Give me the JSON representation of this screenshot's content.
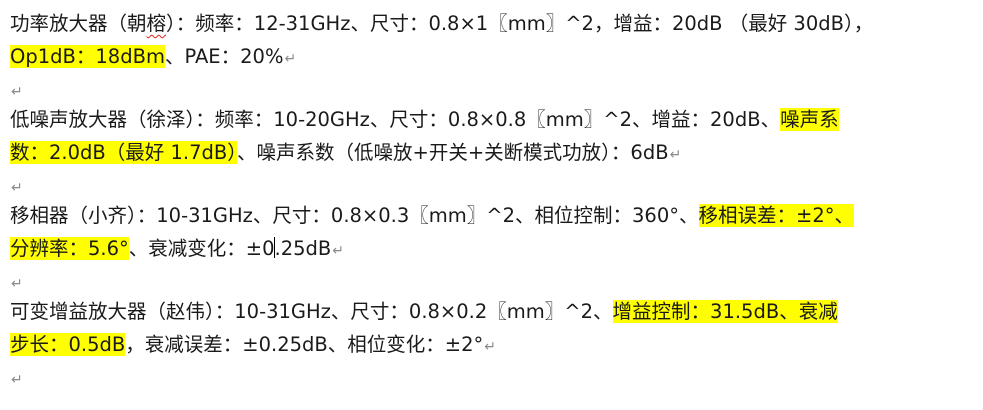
{
  "document": {
    "p1": {
      "line1_a": "功率放大器（朝",
      "line1_name2": "榕",
      "line1_b": "）：频率：12-31GHz、尺寸：0.8×1〖mm〗^2，增益：20dB （最好 30dB），",
      "line2_hl": "Op1dB：18dBm",
      "line2_rest": "、PAE：20%"
    },
    "p2": {
      "line1_text": "低噪声放大器（徐泽）：频率：10-20GHz、尺寸：0.8×0.8〖mm〗^2、增益：20dB、",
      "line1_hl": "噪声系",
      "line2_hl": "数：2.0dB（最好 1.7dB）",
      "line2_rest": "、噪声系数（低噪放+开关+关断模式功放）：6dB"
    },
    "p3": {
      "line1_text": "移相器（小齐）：10-31GHz、尺寸：0.8×0.3〖mm〗^2、相位控制：360°、",
      "line1_hl": "移相误差：±2°、",
      "line2_hl": "分辨率：5.6°",
      "line2_rest_a": "、衰减变化：±0",
      "line2_rest_b": ".25dB"
    },
    "p4": {
      "line1_text": "可变增益放大器（赵伟）：10-31GHz、尺寸：0.8×0.2〖mm〗^2、",
      "line1_hl": "增益控制：31.5dB、衰减",
      "line2_hl": "步长：0.5dB",
      "line2_rest": "，衰减误差：±0.25dB、相位变化：±2°"
    },
    "paragraph_mark": "↵"
  }
}
